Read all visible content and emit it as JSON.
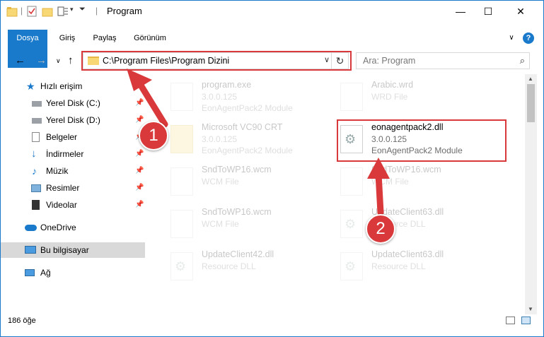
{
  "window": {
    "title": "Program",
    "controls": {
      "minimize": "—",
      "maximize": "☐",
      "close": "✕"
    }
  },
  "ribbon": {
    "tabs": [
      "Dosya",
      "Giriş",
      "Paylaş",
      "Görünüm"
    ],
    "help": "?",
    "expand": "∨"
  },
  "address": {
    "path": "C:\\Program Files\\Program Dizini",
    "dropdown": "∨",
    "refresh": "↻"
  },
  "search": {
    "placeholder": "Ara: Program"
  },
  "nav": {
    "items": [
      {
        "label": "Hızlı erişim",
        "icon": "star-icon",
        "pinned": false
      },
      {
        "label": "Yerel Disk (C:)",
        "icon": "drive-icon",
        "pinned": true
      },
      {
        "label": "Yerel Disk (D:)",
        "icon": "drive-icon",
        "pinned": true
      },
      {
        "label": "Belgeler",
        "icon": "documents-icon",
        "pinned": true
      },
      {
        "label": "İndirmeler",
        "icon": "download-icon",
        "pinned": true
      },
      {
        "label": "Müzik",
        "icon": "music-icon",
        "pinned": true
      },
      {
        "label": "Resimler",
        "icon": "pictures-icon",
        "pinned": true
      },
      {
        "label": "Videolar",
        "icon": "video-icon",
        "pinned": true
      },
      {
        "label": "OneDrive",
        "icon": "cloud-icon",
        "pinned": false
      },
      {
        "label": "Bu bilgisayar",
        "icon": "computer-icon",
        "pinned": false,
        "selected": true
      },
      {
        "label": "Ağ",
        "icon": "network-icon",
        "pinned": false
      }
    ]
  },
  "files": [
    {
      "name": "program.exe",
      "line2": "3.0.0.125",
      "line3": "EonAgentPack2 Module",
      "faded": true
    },
    {
      "name": "Arabic.wrd",
      "line2": "WRD File",
      "line3": "",
      "faded": true
    },
    {
      "name": "Microsoft VC90 CRT",
      "line2": "3.0.0.125",
      "line3": "EonAgentPack2 Module",
      "faded": true
    },
    {
      "name": "eonagentpack2.dll",
      "line2": "3.0.0.125",
      "line3": "EonAgentPack2 Module",
      "faded": false
    },
    {
      "name": "SndToWP16.wcm",
      "line2": "WCM File",
      "line3": "",
      "faded": true
    },
    {
      "name": "SndToWP16.wcm",
      "line2": "WCM File",
      "line3": "",
      "faded": true
    },
    {
      "name": "SndToWP16.wcm",
      "line2": "WCM File",
      "line3": "",
      "faded": true
    },
    {
      "name": "UpdateClient63.dll",
      "line2": "Resource DLL",
      "line3": "",
      "faded": true
    },
    {
      "name": "UpdateClient42.dll",
      "line2": "Resource DLL",
      "line3": "",
      "faded": true
    },
    {
      "name": "UpdateClient63.dll",
      "line2": "Resource DLL",
      "line3": "",
      "faded": true
    }
  ],
  "status": {
    "count": "186 öğe"
  },
  "annotations": {
    "badge1": "1",
    "badge2": "2"
  },
  "colors": {
    "accent": "#1979ca",
    "highlight": "#d9393a"
  }
}
